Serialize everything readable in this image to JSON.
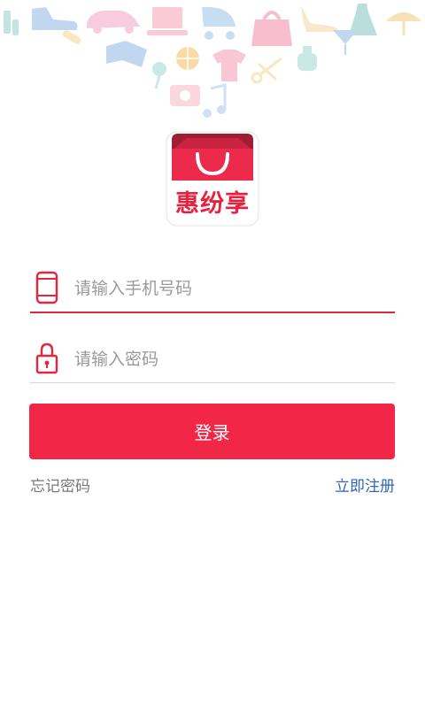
{
  "logo": {
    "text": "惠纷享"
  },
  "phone_input": {
    "placeholder": "请输入手机号码",
    "value": ""
  },
  "password_input": {
    "placeholder": "请输入密码",
    "value": ""
  },
  "login_button": {
    "label": "登录"
  },
  "forgot_password": {
    "label": "忘记密码"
  },
  "register": {
    "label": "立即注册"
  },
  "colors": {
    "accent": "#f22748",
    "active_underline": "#e3253f",
    "inactive_underline": "#d6d6d6",
    "link_blue": "#2f66b3",
    "secondary_text": "#777777"
  },
  "icons": {
    "phone": "mobile-phone-icon",
    "password": "padlock-icon"
  }
}
